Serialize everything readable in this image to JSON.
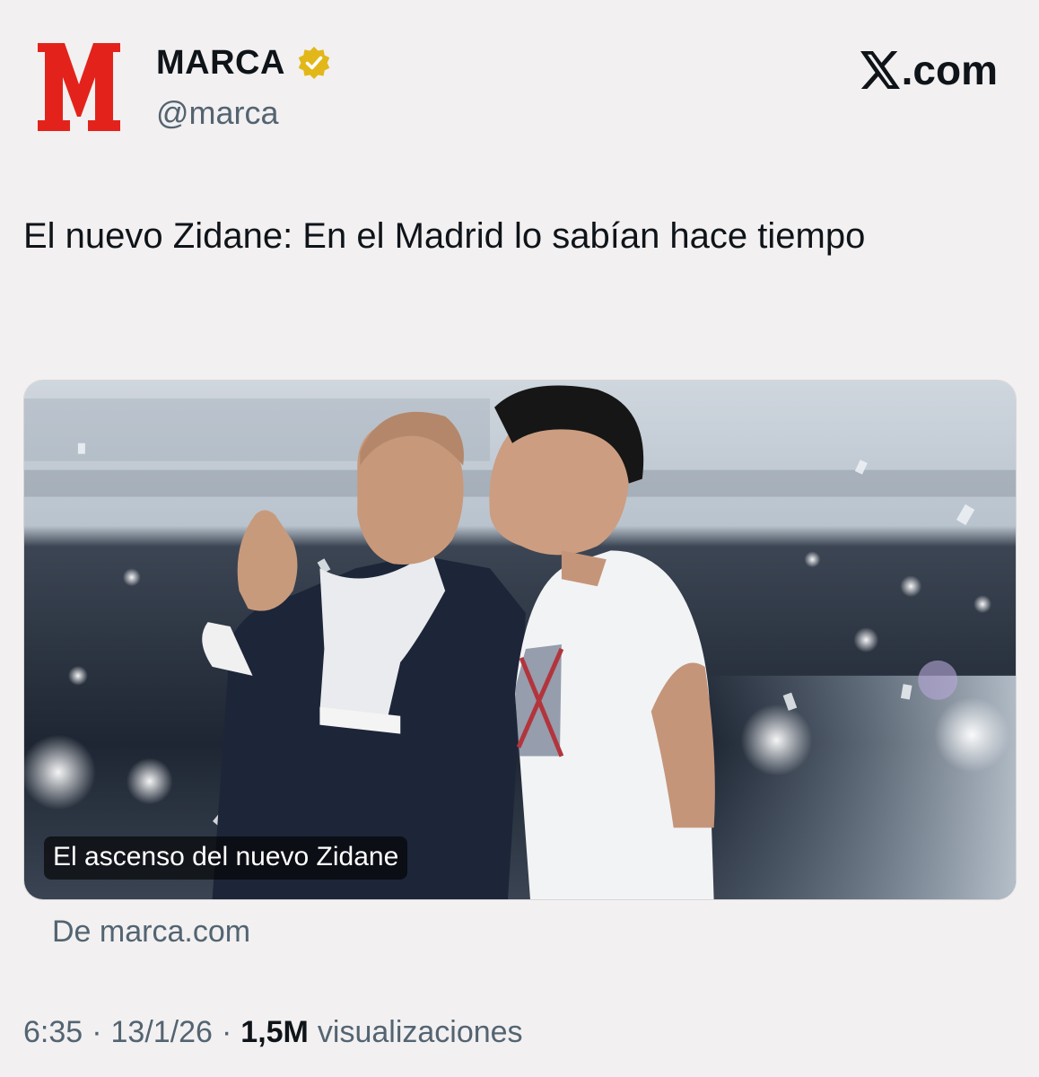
{
  "account": {
    "display_name": "MARCA",
    "handle": "@marca",
    "logo_letter": "M",
    "logo_icon": "marca-logo-icon",
    "verified_icon": "verified-badge-icon",
    "verified_color": "#e2b719"
  },
  "brand": {
    "site_suffix": ".com",
    "logo_icon": "x-logo-icon"
  },
  "tweet": {
    "text": "El nuevo Zidane: En el Madrid lo sabían hace tiempo"
  },
  "card": {
    "image_icon": "article-photo",
    "title": "El ascenso del nuevo Zidane",
    "source_label": "De marca.com"
  },
  "meta": {
    "time": "6:35",
    "separator": "·",
    "date": "13/1/26",
    "views_count": "1,5M",
    "views_label": "visualizaciones"
  },
  "colors": {
    "background": "#f2f0f1",
    "text_primary": "#0f1419",
    "text_secondary": "#536471",
    "marca_red": "#e3231b"
  }
}
